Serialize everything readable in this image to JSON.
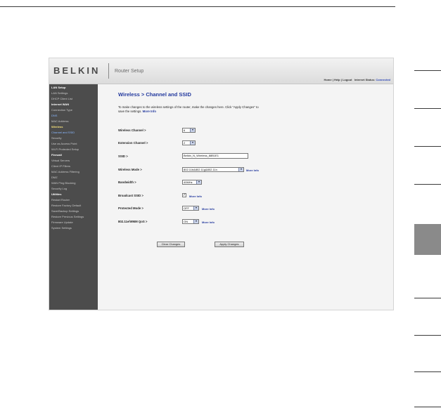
{
  "header": {
    "brand": "BELKIN",
    "title": "Router Setup",
    "links": [
      "Home",
      "Help",
      "Logout"
    ],
    "status_label": "Internet Status:",
    "status_value": "Connected"
  },
  "sidebar": {
    "items": [
      {
        "label": "LAN Setup",
        "kind": "sec"
      },
      {
        "label": "LAN Settings",
        "kind": "item"
      },
      {
        "label": "DHCP Client List",
        "kind": "item"
      },
      {
        "label": "Internet WAN",
        "kind": "sec"
      },
      {
        "label": "Connection Type",
        "kind": "item"
      },
      {
        "label": "DNS",
        "kind": "link"
      },
      {
        "label": "MAC Address",
        "kind": "item"
      },
      {
        "label": "Wireless",
        "kind": "active"
      },
      {
        "label": "Channel and SSID",
        "kind": "link"
      },
      {
        "label": "Security",
        "kind": "item"
      },
      {
        "label": "Use as Access Point",
        "kind": "item"
      },
      {
        "label": "Wi-Fi Protected Setup",
        "kind": "item"
      },
      {
        "label": "Firewall",
        "kind": "sec"
      },
      {
        "label": "Virtual Servers",
        "kind": "item"
      },
      {
        "label": "Client IP Filters",
        "kind": "item"
      },
      {
        "label": "MAC Address Filtering",
        "kind": "item"
      },
      {
        "label": "DMZ",
        "kind": "item"
      },
      {
        "label": "WAN Ping Blocking",
        "kind": "item"
      },
      {
        "label": "Security Log",
        "kind": "item"
      },
      {
        "label": "Utilities",
        "kind": "sec"
      },
      {
        "label": "Restart Router",
        "kind": "item"
      },
      {
        "label": "Restore Factory Default",
        "kind": "item"
      },
      {
        "label": "Save/Backup Settings",
        "kind": "item"
      },
      {
        "label": "Restore Previous Settings",
        "kind": "item"
      },
      {
        "label": "Firmware Update",
        "kind": "item"
      },
      {
        "label": "System Settings",
        "kind": "item"
      }
    ]
  },
  "main": {
    "title": "Wireless > Channel and SSID",
    "intro": "To make changes to the wireless settings of the router, make the changes here. Click \"Apply Changes\" to save the settings.",
    "intro_more": "More Info",
    "fields": {
      "wireless_channel": {
        "label": "Wireless Channel >",
        "value": "6"
      },
      "extension_channel": {
        "label": "Extension Channel >",
        "value": "2"
      },
      "ssid": {
        "label": "SSID >",
        "value": "Belkin_N_Wireless_88B1E1"
      },
      "wireless_mode": {
        "label": "Wireless Mode >",
        "value": "802.11b&802.11g&802.11n",
        "more": "More Info"
      },
      "bandwidth": {
        "label": "Bandwidth >",
        "value": "40MHz"
      },
      "broadcast_ssid": {
        "label": "Broadcast SSID >",
        "checked": "✓",
        "more": "More Info"
      },
      "protected_mode": {
        "label": "Protected Mode >",
        "value": "OFF",
        "more": "More Info"
      },
      "wmm": {
        "label": "802.11e/WMM QoS >",
        "value": "ON",
        "more": "More Info"
      }
    },
    "buttons": {
      "clear": "Clear Changes",
      "apply": "Apply Changes"
    }
  },
  "colors": {
    "accent": "#23399e",
    "sidebar_bg": "#4c4c4c",
    "active_item": "#f7e27a"
  }
}
